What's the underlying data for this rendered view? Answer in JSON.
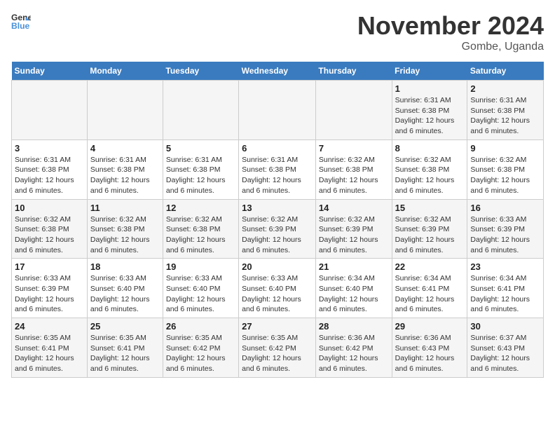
{
  "logo": {
    "line1": "General",
    "line2": "Blue"
  },
  "title": "November 2024",
  "location": "Gombe, Uganda",
  "weekdays": [
    "Sunday",
    "Monday",
    "Tuesday",
    "Wednesday",
    "Thursday",
    "Friday",
    "Saturday"
  ],
  "weeks": [
    [
      {
        "day": "",
        "sunrise": "",
        "sunset": "",
        "daylight": ""
      },
      {
        "day": "",
        "sunrise": "",
        "sunset": "",
        "daylight": ""
      },
      {
        "day": "",
        "sunrise": "",
        "sunset": "",
        "daylight": ""
      },
      {
        "day": "",
        "sunrise": "",
        "sunset": "",
        "daylight": ""
      },
      {
        "day": "",
        "sunrise": "",
        "sunset": "",
        "daylight": ""
      },
      {
        "day": "1",
        "sunrise": "Sunrise: 6:31 AM",
        "sunset": "Sunset: 6:38 PM",
        "daylight": "Daylight: 12 hours and 6 minutes."
      },
      {
        "day": "2",
        "sunrise": "Sunrise: 6:31 AM",
        "sunset": "Sunset: 6:38 PM",
        "daylight": "Daylight: 12 hours and 6 minutes."
      }
    ],
    [
      {
        "day": "3",
        "sunrise": "Sunrise: 6:31 AM",
        "sunset": "Sunset: 6:38 PM",
        "daylight": "Daylight: 12 hours and 6 minutes."
      },
      {
        "day": "4",
        "sunrise": "Sunrise: 6:31 AM",
        "sunset": "Sunset: 6:38 PM",
        "daylight": "Daylight: 12 hours and 6 minutes."
      },
      {
        "day": "5",
        "sunrise": "Sunrise: 6:31 AM",
        "sunset": "Sunset: 6:38 PM",
        "daylight": "Daylight: 12 hours and 6 minutes."
      },
      {
        "day": "6",
        "sunrise": "Sunrise: 6:31 AM",
        "sunset": "Sunset: 6:38 PM",
        "daylight": "Daylight: 12 hours and 6 minutes."
      },
      {
        "day": "7",
        "sunrise": "Sunrise: 6:32 AM",
        "sunset": "Sunset: 6:38 PM",
        "daylight": "Daylight: 12 hours and 6 minutes."
      },
      {
        "day": "8",
        "sunrise": "Sunrise: 6:32 AM",
        "sunset": "Sunset: 6:38 PM",
        "daylight": "Daylight: 12 hours and 6 minutes."
      },
      {
        "day": "9",
        "sunrise": "Sunrise: 6:32 AM",
        "sunset": "Sunset: 6:38 PM",
        "daylight": "Daylight: 12 hours and 6 minutes."
      }
    ],
    [
      {
        "day": "10",
        "sunrise": "Sunrise: 6:32 AM",
        "sunset": "Sunset: 6:38 PM",
        "daylight": "Daylight: 12 hours and 6 minutes."
      },
      {
        "day": "11",
        "sunrise": "Sunrise: 6:32 AM",
        "sunset": "Sunset: 6:38 PM",
        "daylight": "Daylight: 12 hours and 6 minutes."
      },
      {
        "day": "12",
        "sunrise": "Sunrise: 6:32 AM",
        "sunset": "Sunset: 6:38 PM",
        "daylight": "Daylight: 12 hours and 6 minutes."
      },
      {
        "day": "13",
        "sunrise": "Sunrise: 6:32 AM",
        "sunset": "Sunset: 6:39 PM",
        "daylight": "Daylight: 12 hours and 6 minutes."
      },
      {
        "day": "14",
        "sunrise": "Sunrise: 6:32 AM",
        "sunset": "Sunset: 6:39 PM",
        "daylight": "Daylight: 12 hours and 6 minutes."
      },
      {
        "day": "15",
        "sunrise": "Sunrise: 6:32 AM",
        "sunset": "Sunset: 6:39 PM",
        "daylight": "Daylight: 12 hours and 6 minutes."
      },
      {
        "day": "16",
        "sunrise": "Sunrise: 6:33 AM",
        "sunset": "Sunset: 6:39 PM",
        "daylight": "Daylight: 12 hours and 6 minutes."
      }
    ],
    [
      {
        "day": "17",
        "sunrise": "Sunrise: 6:33 AM",
        "sunset": "Sunset: 6:39 PM",
        "daylight": "Daylight: 12 hours and 6 minutes."
      },
      {
        "day": "18",
        "sunrise": "Sunrise: 6:33 AM",
        "sunset": "Sunset: 6:40 PM",
        "daylight": "Daylight: 12 hours and 6 minutes."
      },
      {
        "day": "19",
        "sunrise": "Sunrise: 6:33 AM",
        "sunset": "Sunset: 6:40 PM",
        "daylight": "Daylight: 12 hours and 6 minutes."
      },
      {
        "day": "20",
        "sunrise": "Sunrise: 6:33 AM",
        "sunset": "Sunset: 6:40 PM",
        "daylight": "Daylight: 12 hours and 6 minutes."
      },
      {
        "day": "21",
        "sunrise": "Sunrise: 6:34 AM",
        "sunset": "Sunset: 6:40 PM",
        "daylight": "Daylight: 12 hours and 6 minutes."
      },
      {
        "day": "22",
        "sunrise": "Sunrise: 6:34 AM",
        "sunset": "Sunset: 6:41 PM",
        "daylight": "Daylight: 12 hours and 6 minutes."
      },
      {
        "day": "23",
        "sunrise": "Sunrise: 6:34 AM",
        "sunset": "Sunset: 6:41 PM",
        "daylight": "Daylight: 12 hours and 6 minutes."
      }
    ],
    [
      {
        "day": "24",
        "sunrise": "Sunrise: 6:35 AM",
        "sunset": "Sunset: 6:41 PM",
        "daylight": "Daylight: 12 hours and 6 minutes."
      },
      {
        "day": "25",
        "sunrise": "Sunrise: 6:35 AM",
        "sunset": "Sunset: 6:41 PM",
        "daylight": "Daylight: 12 hours and 6 minutes."
      },
      {
        "day": "26",
        "sunrise": "Sunrise: 6:35 AM",
        "sunset": "Sunset: 6:42 PM",
        "daylight": "Daylight: 12 hours and 6 minutes."
      },
      {
        "day": "27",
        "sunrise": "Sunrise: 6:35 AM",
        "sunset": "Sunset: 6:42 PM",
        "daylight": "Daylight: 12 hours and 6 minutes."
      },
      {
        "day": "28",
        "sunrise": "Sunrise: 6:36 AM",
        "sunset": "Sunset: 6:42 PM",
        "daylight": "Daylight: 12 hours and 6 minutes."
      },
      {
        "day": "29",
        "sunrise": "Sunrise: 6:36 AM",
        "sunset": "Sunset: 6:43 PM",
        "daylight": "Daylight: 12 hours and 6 minutes."
      },
      {
        "day": "30",
        "sunrise": "Sunrise: 6:37 AM",
        "sunset": "Sunset: 6:43 PM",
        "daylight": "Daylight: 12 hours and 6 minutes."
      }
    ]
  ]
}
